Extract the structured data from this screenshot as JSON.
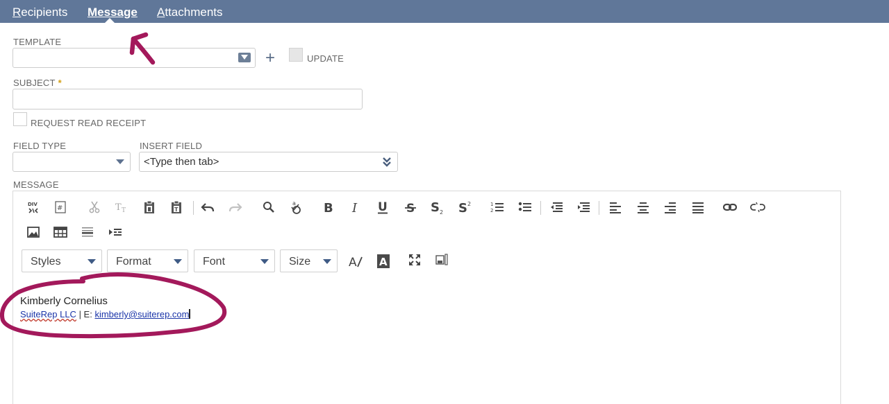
{
  "tabs": [
    {
      "accesskey": "R",
      "rest": "ecipients",
      "active": false
    },
    {
      "accesskey": "M",
      "rest": "essage",
      "active": true
    },
    {
      "accesskey": "A",
      "rest": "ttachments",
      "active": false
    }
  ],
  "form": {
    "template_label": "TEMPLATE",
    "template_value": "",
    "update_label": "UPDATE",
    "subject_label": "SUBJECT",
    "subject_required_mark": "*",
    "subject_value": "",
    "read_receipt_label": "REQUEST READ RECEIPT",
    "field_type_label": "FIELD TYPE",
    "field_type_value": "",
    "insert_field_label": "INSERT FIELD",
    "insert_field_placeholder": "<Type then tab>",
    "message_label": "MESSAGE"
  },
  "editor": {
    "combos": [
      "Styles",
      "Format",
      "Font",
      "Size"
    ],
    "toolbar_icons": [
      "div-container-icon",
      "show-blocks-icon",
      "cut-icon",
      "remove-format-icon",
      "paste-icon",
      "paste-text-icon",
      "undo-icon",
      "redo-icon",
      "find-icon",
      "spellcheck-icon",
      "bold-icon",
      "italic-icon",
      "underline-icon",
      "strikethrough-icon",
      "subscript-icon",
      "superscript-icon",
      "numbered-list-icon",
      "bulleted-list-icon",
      "outdent-icon",
      "indent-icon",
      "align-left-icon",
      "align-center-icon",
      "align-right-icon",
      "justify-icon",
      "link-icon",
      "unlink-icon",
      "image-icon",
      "table-icon",
      "horizontal-rule-icon",
      "page-break-icon",
      "text-color-icon",
      "background-color-icon",
      "maximize-icon",
      "show-source-icon"
    ],
    "content": {
      "name": "Kimberly Cornelius",
      "company": "SuiteRep LLC",
      "separator": " | E: ",
      "email": "kimberly@suiterep.com"
    }
  },
  "annotation_color": "#a3195b"
}
